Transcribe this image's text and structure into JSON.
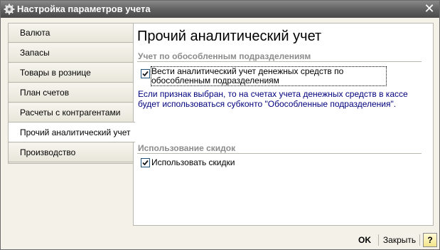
{
  "window": {
    "title": "Настройка параметров учета"
  },
  "tabs": [
    {
      "label": "Валюта",
      "active": false
    },
    {
      "label": "Запасы",
      "active": false
    },
    {
      "label": "Товары в рознице",
      "active": false
    },
    {
      "label": "План счетов",
      "active": false
    },
    {
      "label": "Расчеты с контрагентами",
      "active": false
    },
    {
      "label": "Прочий аналитический учет",
      "active": true
    },
    {
      "label": "Производство",
      "active": false
    }
  ],
  "panel": {
    "title": "Прочий аналитический учет",
    "section1": {
      "title": "Учет по обособленным подразделениям",
      "checkbox_label": "Вести аналитический учет денежных средств по обособленным подразделениям",
      "checked": true,
      "info": "Если признак выбран, то на счетах учета денежных средств в кассе будет использоваться субконто \"Обособленные подразделения\"."
    },
    "section2": {
      "title": "Использование скидок",
      "checkbox_label": "Использовать скидки",
      "checked": true
    }
  },
  "buttons": {
    "ok": "OK",
    "close": "Закрыть",
    "help": "?"
  },
  "icons": {
    "title": "gear-icon",
    "close": "close-icon",
    "check": "checkmark-icon"
  }
}
